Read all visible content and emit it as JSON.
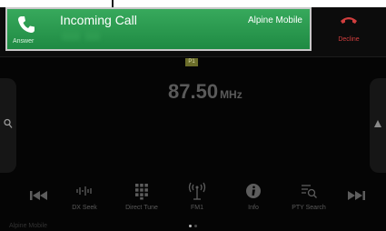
{
  "call": {
    "title": "Incoming Call",
    "source": "Alpine Mobile",
    "answer_label": "Answer",
    "decline_label": "Decline",
    "accent_color": "#2f9e4f",
    "decline_color": "#d13e3e"
  },
  "radio": {
    "preset_badge": "P1",
    "frequency": "87.50",
    "unit": "MHz"
  },
  "controls": [
    {
      "label": "DX Seek",
      "icon": "dx-seek-icon"
    },
    {
      "label": "Direct Tune",
      "icon": "keypad-icon"
    },
    {
      "label": "FM1",
      "icon": "antenna-icon"
    },
    {
      "label": "Info",
      "icon": "info-icon"
    },
    {
      "label": "PTY Search",
      "icon": "pty-search-icon"
    }
  ],
  "page_indicator": {
    "current": 1,
    "total": 2
  },
  "footer": {
    "label": "Alpine Mobile"
  }
}
